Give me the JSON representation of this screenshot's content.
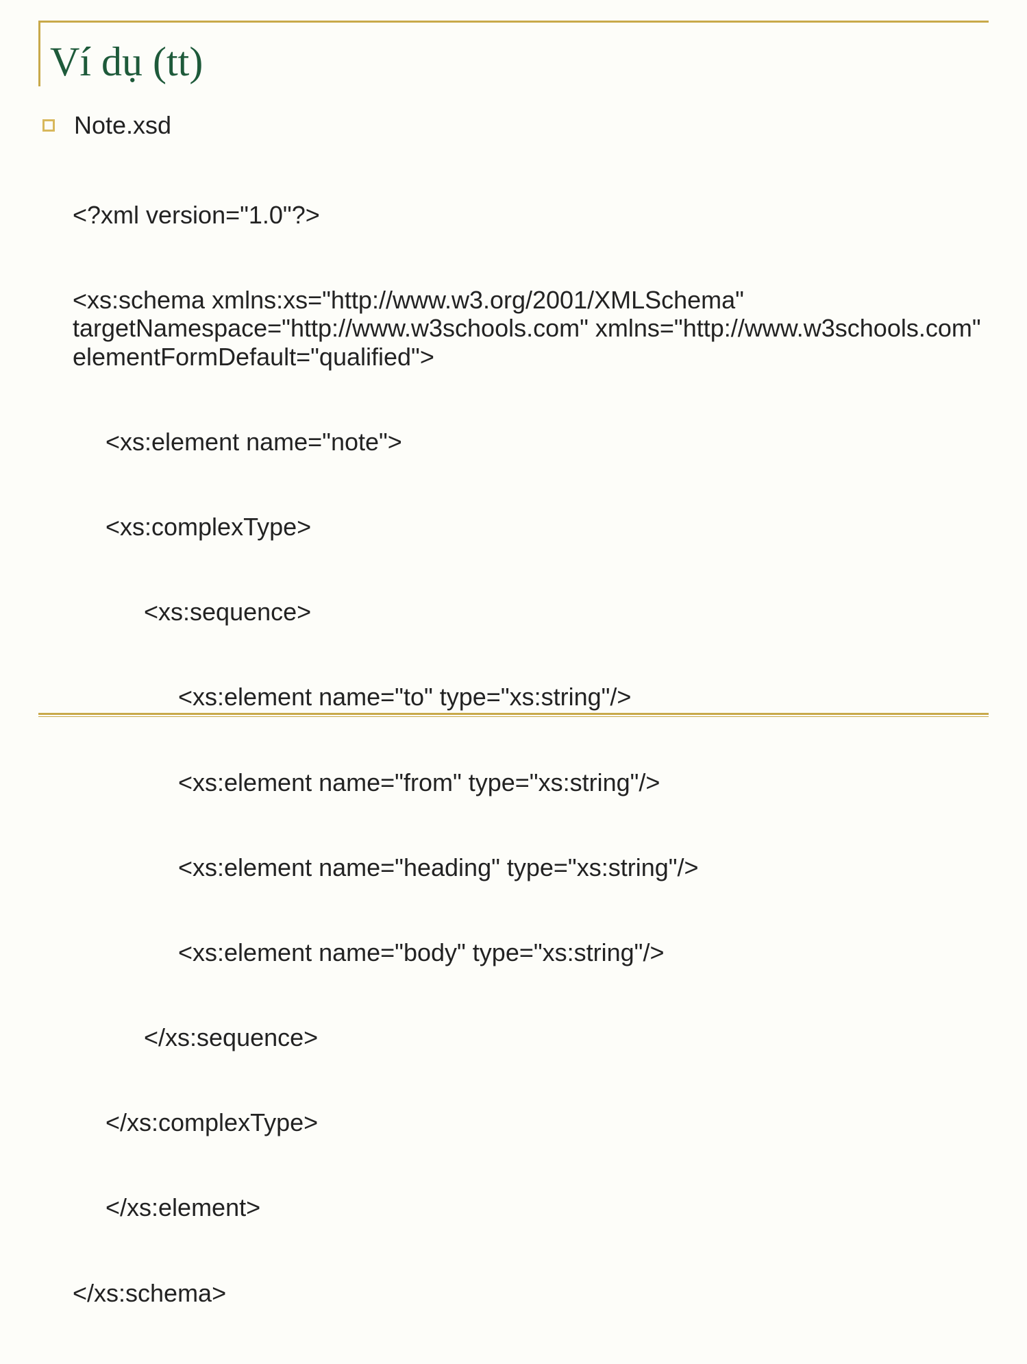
{
  "slide": {
    "title": "Ví dụ (tt)",
    "bullet_label": "Note.xsd",
    "code": {
      "l01": "<?xml version=\"1.0\"?>",
      "l02": "<xs:schema xmlns:xs=\"http://www.w3.org/2001/XMLSchema\" targetNamespace=\"http://www.w3schools.com\" xmlns=\"http://www.w3schools.com\" elementFormDefault=\"qualified\">",
      "l03": "<xs:element name=\"note\">",
      "l04": "<xs:complexType>",
      "l05": "<xs:sequence>",
      "l06": "<xs:element name=\"to\" type=\"xs:string\"/>",
      "l07": "<xs:element name=\"from\" type=\"xs:string\"/>",
      "l08": "<xs:element name=\"heading\" type=\"xs:string\"/>",
      "l09": "<xs:element name=\"body\" type=\"xs:string\"/>",
      "l10": "</xs:sequence>",
      "l11": "</xs:complexType>",
      "l12": "</xs:element>",
      "l13": "</xs:schema>"
    }
  }
}
